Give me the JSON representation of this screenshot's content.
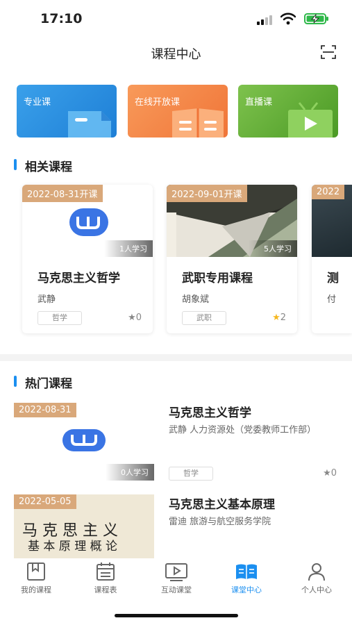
{
  "status_bar": {
    "time": "17:10"
  },
  "nav": {
    "title": "课程中心"
  },
  "tiles": [
    {
      "label": "专业课",
      "color": "#2a8fe0"
    },
    {
      "label": "在线开放课",
      "color": "#f2834a"
    },
    {
      "label": "直播课",
      "color": "#5fa93a"
    }
  ],
  "related": {
    "heading": "相关课程",
    "cards": [
      {
        "date": "2022-08-31开课",
        "learners": "1人学习",
        "title": "马克思主义哲学",
        "author": "武静",
        "tag": "哲学",
        "rating": "0"
      },
      {
        "date": "2022-09-01开课",
        "learners": "5人学习",
        "title": "武职专用课程",
        "author": "胡象斌",
        "tag": "武职",
        "rating": "2"
      },
      {
        "date": "2022",
        "title": "测",
        "author": "付"
      }
    ]
  },
  "hot": {
    "heading": "热门课程",
    "items": [
      {
        "date": "2022-08-31",
        "learners": "0人学习",
        "title": "马克思主义哲学",
        "meta": "武静  人力资源处（党委教师工作部）",
        "tag": "哲学",
        "rating": "0"
      },
      {
        "date": "2022-05-05",
        "title": "马克思主义基本原理",
        "meta": "雷迪  旅游与航空服务学院",
        "cover_text_1": "马 克 思 主 义",
        "cover_text_2": "基 本 原 理 概 论"
      }
    ]
  },
  "tabbar": {
    "active_color": "#1b8ff0",
    "tabs": [
      {
        "label": "我的课程",
        "icon": "bookmark-book-icon"
      },
      {
        "label": "课程表",
        "icon": "calendar-icon"
      },
      {
        "label": "互动课堂",
        "icon": "play-screen-icon"
      },
      {
        "label": "课堂中心",
        "icon": "open-book-icon",
        "active": true
      },
      {
        "label": "个人中心",
        "icon": "person-icon"
      }
    ]
  }
}
